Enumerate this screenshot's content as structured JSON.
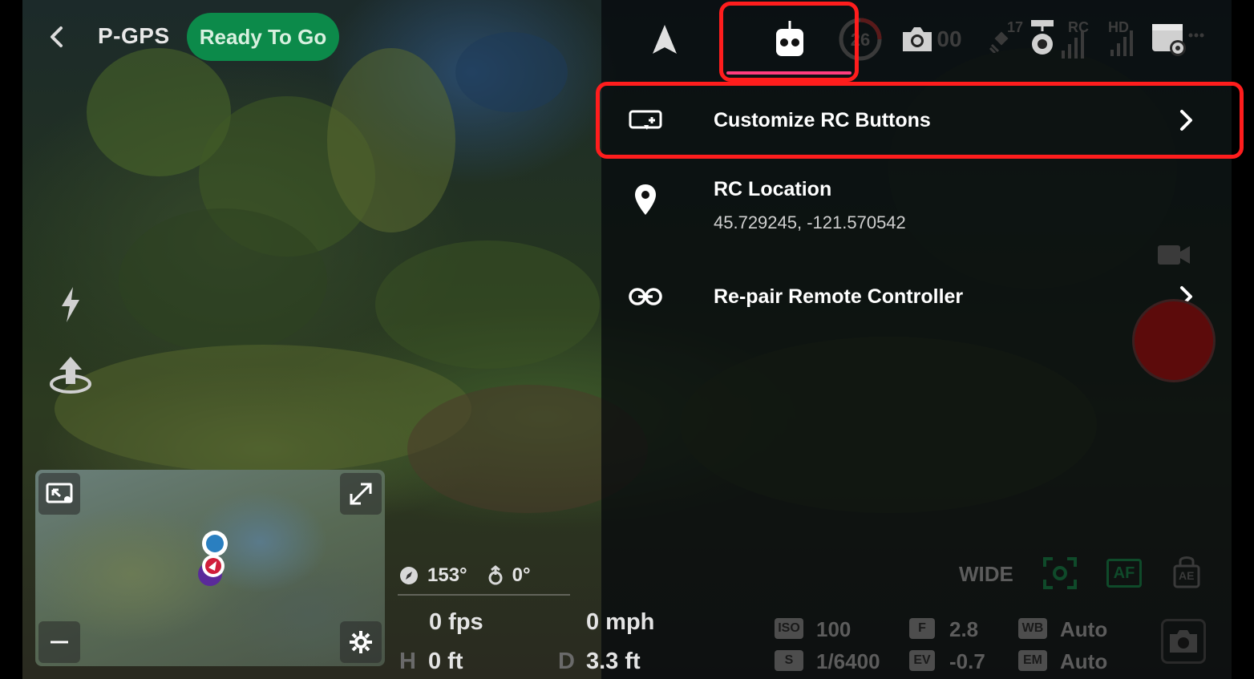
{
  "header": {
    "back_icon": "chevron-left-icon",
    "mode": "P-GPS",
    "status": "Ready To Go",
    "status_color": "#0c8a4a"
  },
  "tabs": [
    {
      "icon": "navigation-arrow-icon",
      "active": false
    },
    {
      "icon": "remote-controller-icon",
      "active": true
    },
    {
      "icon": "battery-ring-icon",
      "text": "26",
      "active": false
    },
    {
      "icon": "camera-icon",
      "text": "00",
      "active": false
    },
    {
      "icon": "satellite-icon",
      "text": "17",
      "active": false
    },
    {
      "icon": "gimbal-signal-icon",
      "text": "RC",
      "active": false
    },
    {
      "icon": "hd-signal-icon",
      "text": "HD",
      "active": false
    },
    {
      "icon": "settings-card-icon",
      "active": false
    }
  ],
  "accent_color": "#ff3d7f",
  "highlight_color": "#ff1d1d",
  "settings": {
    "customize": {
      "label": "Customize RC Buttons",
      "icon": "rc-buttons-icon"
    },
    "location": {
      "label": "RC Location",
      "value": "45.729245, -121.570542",
      "icon": "location-pin-icon"
    },
    "repair": {
      "label": "Re-pair Remote Controller",
      "icon": "link-icon"
    }
  },
  "left_tools": [
    "lightning-icon",
    "takeoff-icon"
  ],
  "telemetry": {
    "heading": "153°",
    "gimbal": "0°",
    "fps": "0 fps",
    "speed": "0 mph",
    "h_label": "H",
    "height": "0 ft",
    "d_label": "D",
    "distance": "3.3 ft"
  },
  "camera_params": {
    "lens": "WIDE",
    "af": "AF",
    "ae": "AE",
    "iso_label": "ISO",
    "iso": "100",
    "f_label": "F",
    "aperture": "2.8",
    "wb_label": "WB",
    "wb": "Auto",
    "s_label": "S",
    "shutter": "1/6400",
    "ev_label": "EV",
    "ev": "-0.7",
    "em_label": "EM",
    "em": "Auto"
  }
}
